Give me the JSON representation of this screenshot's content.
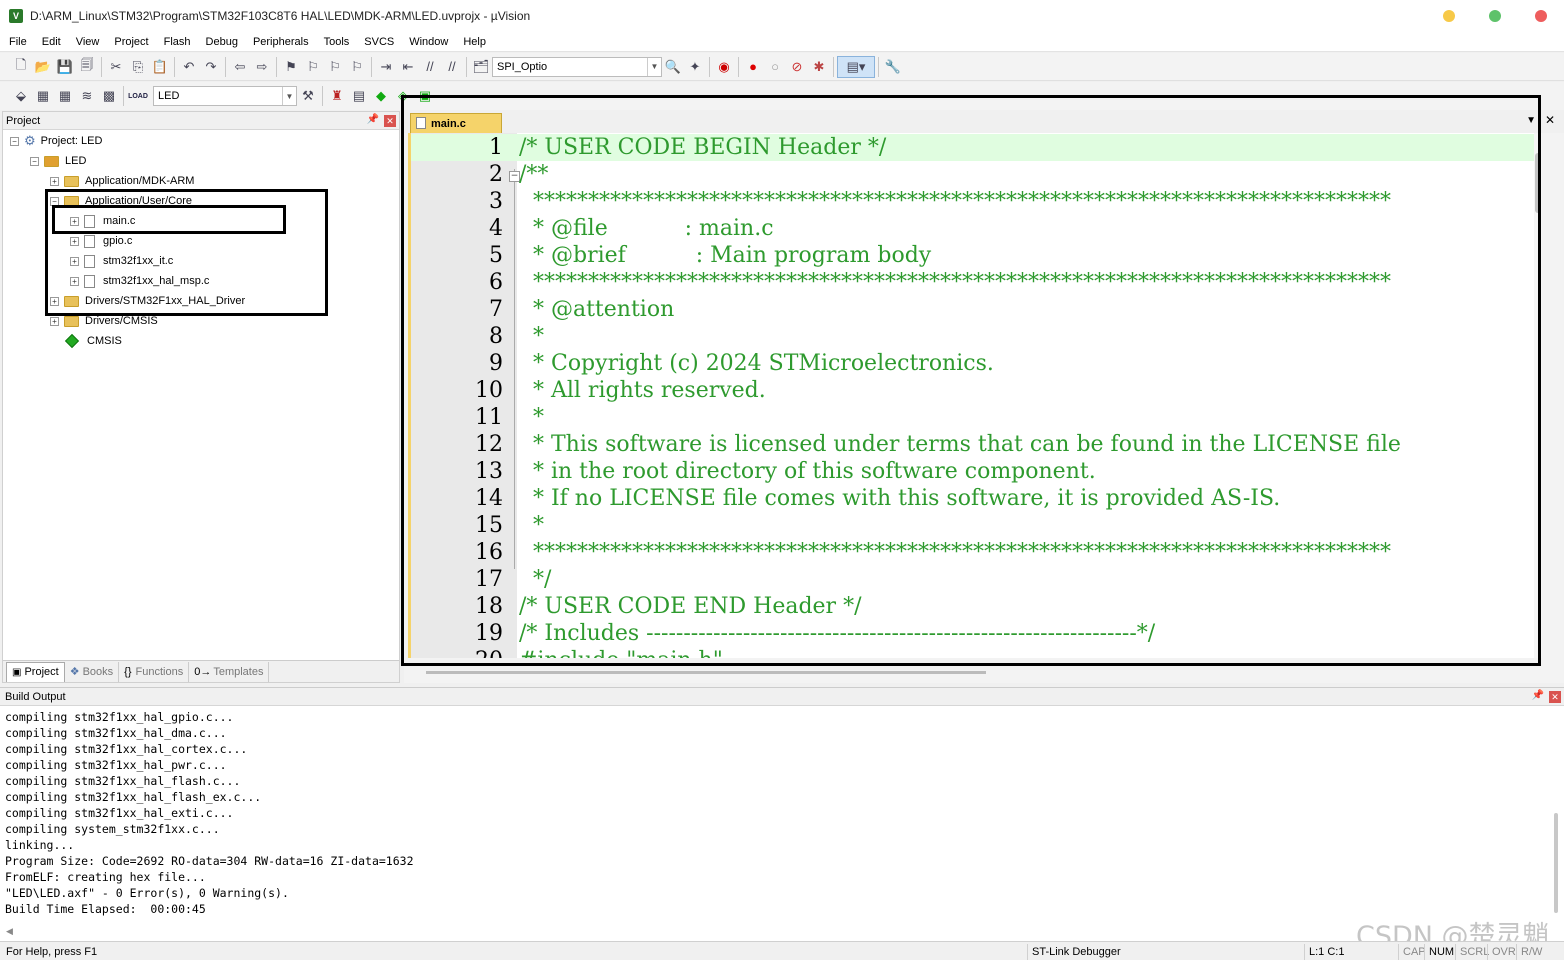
{
  "titlebar": {
    "icon_letter": "V",
    "title": "D:\\ARM_Linux\\STM32\\Program\\STM32F103C8T6 HAL\\LED\\MDK-ARM\\LED.uvprojx - µVision",
    "colors": {
      "minimize": "#f7c948",
      "maximize": "#5ec26a",
      "close": "#ee5d5d"
    }
  },
  "menu": [
    "File",
    "Edit",
    "View",
    "Project",
    "Flash",
    "Debug",
    "Peripherals",
    "Tools",
    "SVCS",
    "Window",
    "Help"
  ],
  "toolbar1": {
    "combo_value": "SPI_Optio"
  },
  "toolbar2": {
    "target_value": "LED",
    "load_label": "LOAD"
  },
  "project_panel": {
    "title": "Project",
    "tree": {
      "root": "Project: LED",
      "target": "LED",
      "groups": [
        "Application/MDK-ARM",
        "Application/User/Core",
        "Drivers/STM32F1xx_HAL_Driver",
        "Drivers/CMSIS"
      ],
      "files": [
        "main.c",
        "gpio.c",
        "stm32f1xx_it.c",
        "stm32f1xx_hal_msp.c"
      ],
      "cmsis": "CMSIS"
    },
    "tabs": [
      "Project",
      "Books",
      "Functions",
      "Templates"
    ],
    "tab_icons": [
      "{}",
      "0→"
    ]
  },
  "editor": {
    "tab_label": "main.c",
    "lines": [
      {
        "n": "1",
        "t": "/* USER CODE BEGIN Header */"
      },
      {
        "n": "2",
        "t": "/**"
      },
      {
        "n": "3",
        "t": "  ******************************************************************************"
      },
      {
        "n": "4",
        "t": "  * @file           : main.c"
      },
      {
        "n": "5",
        "t": "  * @brief          : Main program body"
      },
      {
        "n": "6",
        "t": "  ******************************************************************************"
      },
      {
        "n": "7",
        "t": "  * @attention"
      },
      {
        "n": "8",
        "t": "  *"
      },
      {
        "n": "9",
        "t": "  * Copyright (c) 2024 STMicroelectronics."
      },
      {
        "n": "10",
        "t": "  * All rights reserved."
      },
      {
        "n": "11",
        "t": "  *"
      },
      {
        "n": "12",
        "t": "  * This software is licensed under terms that can be found in the LICENSE file"
      },
      {
        "n": "13",
        "t": "  * in the root directory of this software component."
      },
      {
        "n": "14",
        "t": "  * If no LICENSE file comes with this software, it is provided AS-IS."
      },
      {
        "n": "15",
        "t": "  *"
      },
      {
        "n": "16",
        "t": "  ******************************************************************************"
      },
      {
        "n": "17",
        "t": "  */"
      },
      {
        "n": "18",
        "t": "/* USER CODE END Header */"
      },
      {
        "n": "19",
        "t": "/* Includes ------------------------------------------------------------------*/"
      },
      {
        "n": "20",
        "t": "#include \"main.h\""
      }
    ],
    "code_color": "#2e9a2e",
    "current_line_color": "#e0fde0"
  },
  "build_output": {
    "title": "Build Output",
    "lines": [
      "compiling stm32f1xx_hal_gpio.c...",
      "compiling stm32f1xx_hal_dma.c...",
      "compiling stm32f1xx_hal_cortex.c...",
      "compiling stm32f1xx_hal_pwr.c...",
      "compiling stm32f1xx_hal_flash.c...",
      "compiling stm32f1xx_hal_flash_ex.c...",
      "compiling stm32f1xx_hal_exti.c...",
      "compiling system_stm32f1xx.c...",
      "linking...",
      "Program Size: Code=2692 RO-data=304 RW-data=16 ZI-data=1632",
      "FromELF: creating hex file...",
      "\"LED\\LED.axf\" - 0 Error(s), 0 Warning(s).",
      "Build Time Elapsed:  00:00:45"
    ]
  },
  "status": {
    "help": "For Help, press F1",
    "debugger": "ST-Link Debugger",
    "position": "L:1 C:1",
    "indicators": [
      "CAP",
      "NUM",
      "SCRL",
      "OVR",
      "R/W"
    ]
  },
  "watermark": "CSDN @楚灵魈"
}
